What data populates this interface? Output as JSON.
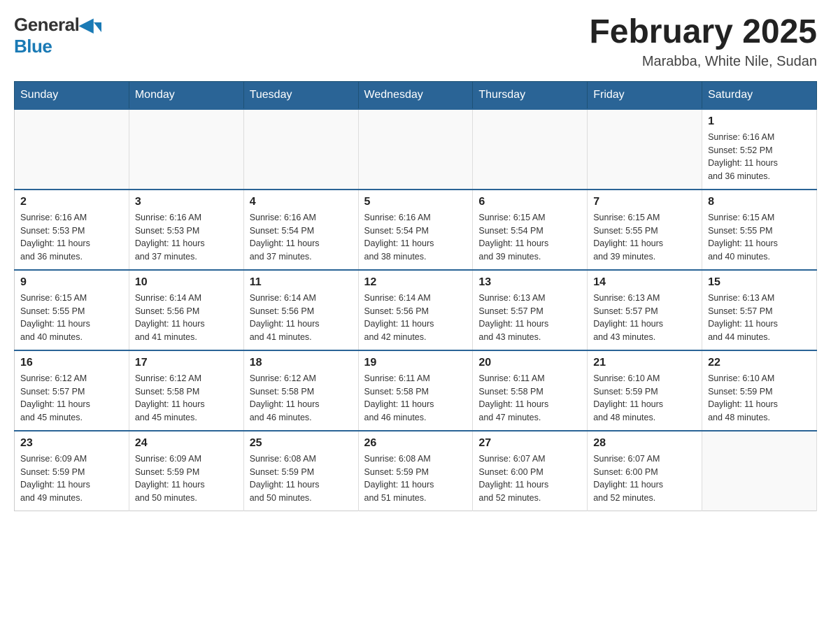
{
  "logo": {
    "general": "General",
    "blue": "Blue"
  },
  "title": {
    "month_year": "February 2025",
    "location": "Marabba, White Nile, Sudan"
  },
  "weekdays": [
    "Sunday",
    "Monday",
    "Tuesday",
    "Wednesday",
    "Thursday",
    "Friday",
    "Saturday"
  ],
  "weeks": [
    [
      {
        "day": "",
        "info": ""
      },
      {
        "day": "",
        "info": ""
      },
      {
        "day": "",
        "info": ""
      },
      {
        "day": "",
        "info": ""
      },
      {
        "day": "",
        "info": ""
      },
      {
        "day": "",
        "info": ""
      },
      {
        "day": "1",
        "info": "Sunrise: 6:16 AM\nSunset: 5:52 PM\nDaylight: 11 hours\nand 36 minutes."
      }
    ],
    [
      {
        "day": "2",
        "info": "Sunrise: 6:16 AM\nSunset: 5:53 PM\nDaylight: 11 hours\nand 36 minutes."
      },
      {
        "day": "3",
        "info": "Sunrise: 6:16 AM\nSunset: 5:53 PM\nDaylight: 11 hours\nand 37 minutes."
      },
      {
        "day": "4",
        "info": "Sunrise: 6:16 AM\nSunset: 5:54 PM\nDaylight: 11 hours\nand 37 minutes."
      },
      {
        "day": "5",
        "info": "Sunrise: 6:16 AM\nSunset: 5:54 PM\nDaylight: 11 hours\nand 38 minutes."
      },
      {
        "day": "6",
        "info": "Sunrise: 6:15 AM\nSunset: 5:54 PM\nDaylight: 11 hours\nand 39 minutes."
      },
      {
        "day": "7",
        "info": "Sunrise: 6:15 AM\nSunset: 5:55 PM\nDaylight: 11 hours\nand 39 minutes."
      },
      {
        "day": "8",
        "info": "Sunrise: 6:15 AM\nSunset: 5:55 PM\nDaylight: 11 hours\nand 40 minutes."
      }
    ],
    [
      {
        "day": "9",
        "info": "Sunrise: 6:15 AM\nSunset: 5:55 PM\nDaylight: 11 hours\nand 40 minutes."
      },
      {
        "day": "10",
        "info": "Sunrise: 6:14 AM\nSunset: 5:56 PM\nDaylight: 11 hours\nand 41 minutes."
      },
      {
        "day": "11",
        "info": "Sunrise: 6:14 AM\nSunset: 5:56 PM\nDaylight: 11 hours\nand 41 minutes."
      },
      {
        "day": "12",
        "info": "Sunrise: 6:14 AM\nSunset: 5:56 PM\nDaylight: 11 hours\nand 42 minutes."
      },
      {
        "day": "13",
        "info": "Sunrise: 6:13 AM\nSunset: 5:57 PM\nDaylight: 11 hours\nand 43 minutes."
      },
      {
        "day": "14",
        "info": "Sunrise: 6:13 AM\nSunset: 5:57 PM\nDaylight: 11 hours\nand 43 minutes."
      },
      {
        "day": "15",
        "info": "Sunrise: 6:13 AM\nSunset: 5:57 PM\nDaylight: 11 hours\nand 44 minutes."
      }
    ],
    [
      {
        "day": "16",
        "info": "Sunrise: 6:12 AM\nSunset: 5:57 PM\nDaylight: 11 hours\nand 45 minutes."
      },
      {
        "day": "17",
        "info": "Sunrise: 6:12 AM\nSunset: 5:58 PM\nDaylight: 11 hours\nand 45 minutes."
      },
      {
        "day": "18",
        "info": "Sunrise: 6:12 AM\nSunset: 5:58 PM\nDaylight: 11 hours\nand 46 minutes."
      },
      {
        "day": "19",
        "info": "Sunrise: 6:11 AM\nSunset: 5:58 PM\nDaylight: 11 hours\nand 46 minutes."
      },
      {
        "day": "20",
        "info": "Sunrise: 6:11 AM\nSunset: 5:58 PM\nDaylight: 11 hours\nand 47 minutes."
      },
      {
        "day": "21",
        "info": "Sunrise: 6:10 AM\nSunset: 5:59 PM\nDaylight: 11 hours\nand 48 minutes."
      },
      {
        "day": "22",
        "info": "Sunrise: 6:10 AM\nSunset: 5:59 PM\nDaylight: 11 hours\nand 48 minutes."
      }
    ],
    [
      {
        "day": "23",
        "info": "Sunrise: 6:09 AM\nSunset: 5:59 PM\nDaylight: 11 hours\nand 49 minutes."
      },
      {
        "day": "24",
        "info": "Sunrise: 6:09 AM\nSunset: 5:59 PM\nDaylight: 11 hours\nand 50 minutes."
      },
      {
        "day": "25",
        "info": "Sunrise: 6:08 AM\nSunset: 5:59 PM\nDaylight: 11 hours\nand 50 minutes."
      },
      {
        "day": "26",
        "info": "Sunrise: 6:08 AM\nSunset: 5:59 PM\nDaylight: 11 hours\nand 51 minutes."
      },
      {
        "day": "27",
        "info": "Sunrise: 6:07 AM\nSunset: 6:00 PM\nDaylight: 11 hours\nand 52 minutes."
      },
      {
        "day": "28",
        "info": "Sunrise: 6:07 AM\nSunset: 6:00 PM\nDaylight: 11 hours\nand 52 minutes."
      },
      {
        "day": "",
        "info": ""
      }
    ]
  ]
}
